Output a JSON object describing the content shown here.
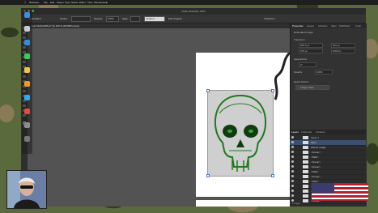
{
  "app": {
    "name": "Illustrator",
    "window_title": "Adobe Illustrator 2023",
    "document_tab": "skull 1920x1080.ai* @ 100 % (RGB/Preview)"
  },
  "menubar": [
    "Illustrator",
    "File",
    "Edit",
    "Object",
    "Type",
    "Select",
    "Effect",
    "View",
    "Window",
    "Help"
  ],
  "control_bar": {
    "selection_label": "Embedded",
    "stroke_label": "Stroke:",
    "basic_label": "Basic",
    "opacity_label": "Opacity:",
    "opacity_value": "100%",
    "style_label": "Style:",
    "action_button": "Embed",
    "edit_button": "Edit Original",
    "transform_label": "Transform"
  },
  "properties_panel": {
    "tabs": [
      "Properties",
      "Layers",
      "Libraries",
      "Align",
      "Pathfinder",
      "Color"
    ],
    "active_tab": "Properties",
    "section_object": "Embedded Image",
    "section_transform": "Transform",
    "x_value": "959.5 px",
    "y_value": "540 px",
    "w_value": "976 px",
    "h_value": "1064 px",
    "angle_value": "0°",
    "section_appearance": "Appearance",
    "opacity_label": "Opacity",
    "opacity_value": "100%",
    "section_quick": "Quick Actions",
    "quick_button": "Image Trace"
  },
  "layers_panel": {
    "tabs": [
      "Layers",
      "Artboards",
      "Libraries"
    ],
    "rows": [
      {
        "name": "Layer 1"
      },
      {
        "name": "Skull"
      },
      {
        "name": "Placed Image"
      },
      {
        "name": "<Group>"
      },
      {
        "name": "<Path>"
      },
      {
        "name": "<Group>"
      },
      {
        "name": "<Group>"
      },
      {
        "name": "<Path>"
      },
      {
        "name": "<Group>"
      },
      {
        "name": "<Path>"
      },
      {
        "name": "<Path>"
      },
      {
        "name": "<Path>"
      },
      {
        "name": "<Path>"
      },
      {
        "name": "<Group>"
      }
    ],
    "footer": "1 Layer"
  },
  "status_bar": {
    "zoom": "100%",
    "tool": "Selection"
  },
  "colors": {
    "accent": "#4a7bd0",
    "skull_green": "#1f7a1f",
    "panel_bg": "#323232",
    "canvas_bg": "#535353"
  },
  "icons": [
    "finder-icon",
    "launchpad-icon",
    "safari-icon",
    "messages-icon",
    "photos-icon",
    "illustrator-icon",
    "photoshop-icon",
    "chrome-icon",
    "settings-icon",
    "trash-icon"
  ]
}
